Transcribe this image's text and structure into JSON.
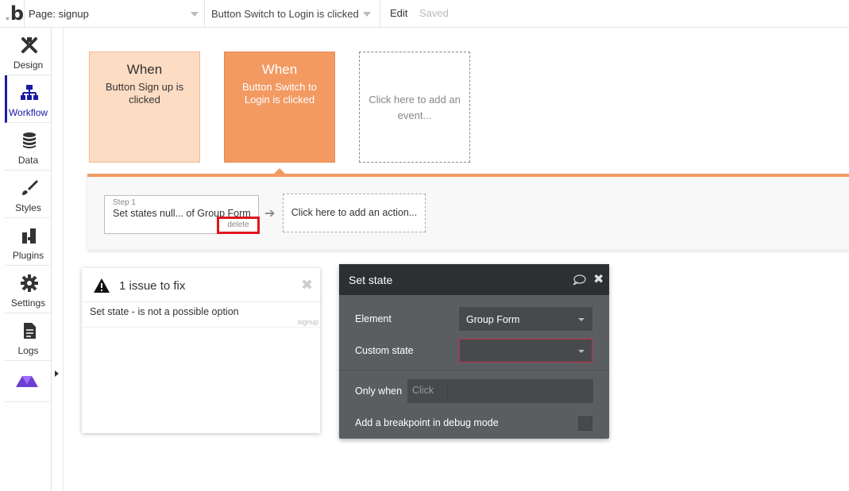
{
  "topbar": {
    "logo": "b",
    "page_select": "Page: signup",
    "event_select": "Button Switch to Login is clicked",
    "edit_label": "Edit",
    "saved_label": "Saved"
  },
  "sidebar": {
    "items": [
      {
        "label": "Design",
        "icon": "design-icon"
      },
      {
        "label": "Workflow",
        "icon": "workflow-icon",
        "active": true
      },
      {
        "label": "Data",
        "icon": "database-icon"
      },
      {
        "label": "Styles",
        "icon": "brush-icon"
      },
      {
        "label": "Plugins",
        "icon": "plug-icon"
      },
      {
        "label": "Settings",
        "icon": "gear-icon"
      },
      {
        "label": "Logs",
        "icon": "document-icon"
      },
      {
        "label": "",
        "icon": "app-logo-icon"
      }
    ],
    "active_color": "#1a1aa6"
  },
  "events": [
    {
      "when": "When",
      "text": "Button Sign up is clicked"
    },
    {
      "when": "When",
      "text": "Button Switch to Login is clicked",
      "selected": true
    },
    {
      "text": "Click here to add an event..."
    }
  ],
  "colors": {
    "event_light": "#fddcc4",
    "event_selected": "#f29a62",
    "highlight_box": "#e0161e",
    "editor_bg": "#5b5e61",
    "editor_header": "#2d3032",
    "error_border": "#c72a4a"
  },
  "actions": {
    "step_label": "Step 1",
    "step_text": "Set states null... of Group Form",
    "delete_label": "delete",
    "add_action": "Click here to add an action..."
  },
  "issues": {
    "title": "1 issue to fix",
    "items": [
      {
        "text": "Set state - is not a possible option",
        "page": "signup"
      }
    ]
  },
  "editor": {
    "title": "Set state",
    "element_label": "Element",
    "element_value": "Group Form",
    "custom_state_label": "Custom state",
    "custom_state_value": "",
    "only_when_label": "Only when",
    "only_when_chip": "Click",
    "breakpoint_label": "Add a breakpoint in debug mode"
  }
}
